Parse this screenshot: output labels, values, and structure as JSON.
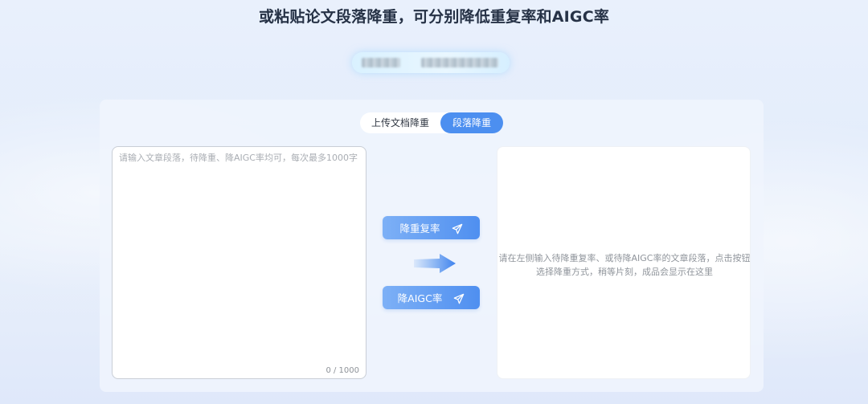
{
  "page": {
    "title": "或粘贴论文段落降重，可分别降低重复率和AIGC率"
  },
  "tabs": [
    {
      "label": "上传文档降重",
      "active": false
    },
    {
      "label": "段落降重",
      "active": true
    }
  ],
  "input": {
    "placeholder": "请输入文章段落，待降重、降AIGC率均可，每次最多1000字",
    "value": "",
    "char_count": "0 / 1000"
  },
  "actions": {
    "rewrite_label": "降重复率",
    "aigc_label": "降AIGC率"
  },
  "output": {
    "placeholder": "请在左侧输入待降重复率、或待降AIGC率的文章段落，点击按钮选择降重方式，稍等片刻，成品会显示在这里"
  },
  "colors": {
    "accent": "#4c8ff0",
    "title": "#263246",
    "background": "#e6eefb"
  },
  "icons": [
    "send-icon",
    "right-arrow-icon"
  ]
}
